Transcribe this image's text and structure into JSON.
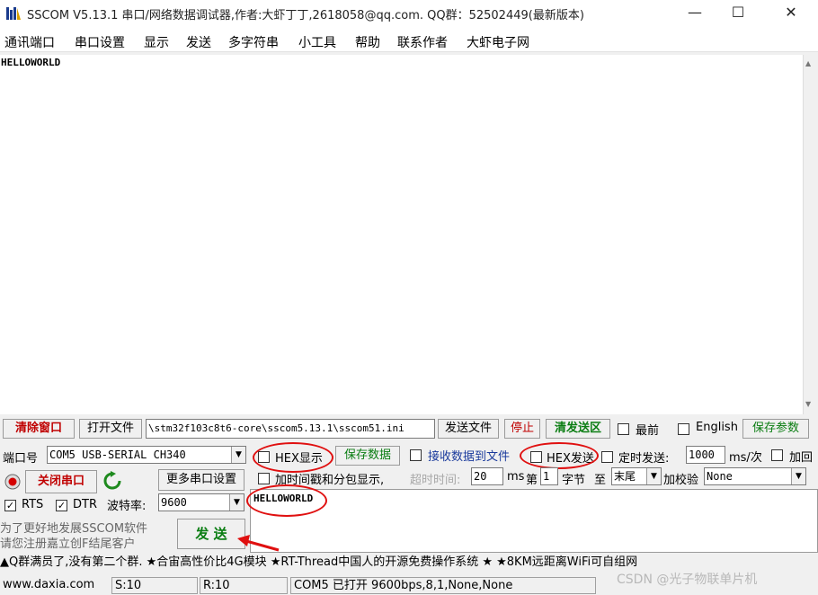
{
  "window": {
    "title": "SSCOM V5.13.1 串口/网络数据调试器,作者:大虾丁丁,2618058@qq.com. QQ群：52502449(最新版本)",
    "minimize": "—",
    "maximize": "☐",
    "close": "✕"
  },
  "menu": [
    "通讯端口",
    "串口设置",
    "显示",
    "发送",
    "多字符串",
    "小工具",
    "帮助",
    "联系作者",
    "大虾电子网"
  ],
  "receive": {
    "text": "HELLOWORLD"
  },
  "toolbar": {
    "clear_window": "清除窗口",
    "open_file": "打开文件",
    "file_path": "\\stm32f103c8t6-core\\sscom5.13.1\\sscom51.ini",
    "send_file": "发送文件",
    "stop": "停止",
    "clear_send": "清发送区",
    "front": "最前",
    "english": "English",
    "save_params": "保存参数"
  },
  "port": {
    "port_label": "端口号",
    "port_value": "COM5 USB-SERIAL CH340",
    "close_port": "关闭串口",
    "more_settings": "更多串口设置",
    "rts": "RTS",
    "dtr": "DTR",
    "baud_label": "波特率:",
    "baud_value": "9600"
  },
  "options": {
    "hex_display": "HEX显示",
    "save_data": "保存数据",
    "recv_to_file": "接收数据到文件",
    "hex_send": "HEX发送",
    "timed_send": "定时发送:",
    "interval": "1000",
    "interval_unit": "ms/次",
    "add_return": "加回",
    "timestamp": "加时间戳和分包显示,",
    "timeout_label": "超时时间:",
    "timeout_value": "20",
    "ms": "ms",
    "nth": "第",
    "byte_index": "1",
    "byte_label": "字节",
    "to": "至",
    "end": "末尾",
    "checksum_label": "加校验",
    "checksum_value": "None"
  },
  "send": {
    "text": "HELLOWORLD",
    "button": "发  送",
    "promo_line1": "为了更好地发展SSCOM软件",
    "promo_line2": "请您注册嘉立创F结尾客户"
  },
  "ticker": "▲Q群满员了,没有第二个群. ★合宙高性价比4G模块 ★RT-Thread中国人的开源免费操作系统 ★ ★8KM远距离WiFi可自组网",
  "status": {
    "site": "www.daxia.com",
    "sent": "S:10",
    "received": "R:10",
    "port_state": "COM5 已打开  9600bps,8,1,None,None"
  },
  "watermark": "CSDN @光子物联单片机",
  "colors": {
    "annotation": "#e01010",
    "accent_red": "#c00000",
    "accent_green": "#0a7d12"
  }
}
